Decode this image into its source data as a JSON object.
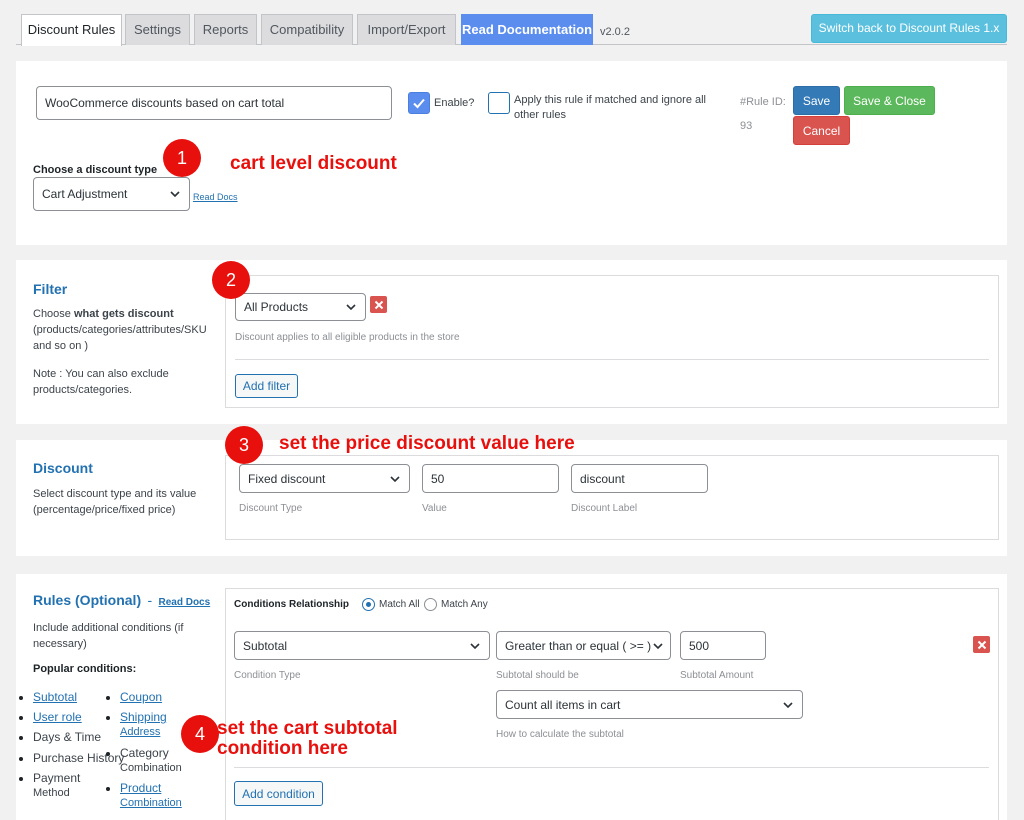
{
  "tabs": [
    {
      "label": "Discount Rules",
      "active": true
    },
    {
      "label": "Settings"
    },
    {
      "label": "Reports"
    },
    {
      "label": "Compatibility"
    },
    {
      "label": "Import/Export"
    },
    {
      "label": "Read Documentation"
    }
  ],
  "version": "v2.0.2",
  "switch_back_label": "Switch back to Discount Rules 1.x",
  "rule": {
    "title_value": "WooCommerce discounts based on cart total",
    "enable_label": "Enable?",
    "enable_checked": true,
    "apply_label_line1": "Apply this rule if matched and ignore all",
    "apply_label_line2": "other rules",
    "rule_id_label": "#Rule ID:",
    "rule_id_value": "93",
    "save_label": "Save",
    "save_close_label": "Save & Close",
    "cancel_label": "Cancel",
    "discount_type_label": "Choose a discount type",
    "discount_type_value": "Cart Adjustment",
    "read_docs_label": "Read Docs"
  },
  "filter": {
    "title": "Filter",
    "desc_prefix": "Choose ",
    "desc_bold": "what gets discount",
    "desc_line2": "(products/categories/attributes/SKU",
    "desc_line3": "and so on )",
    "note_line1": "Note : You can also exclude",
    "note_line2": "products/categories.",
    "select_value": "All Products",
    "hint": "Discount applies to all eligible products in the store",
    "add_filter_label": "Add filter"
  },
  "discount": {
    "title": "Discount",
    "desc_line1": "Select discount type and its value",
    "desc_line2": "(percentage/price/fixed price)",
    "type_value": "Fixed discount",
    "type_hint": "Discount Type",
    "value_value": "50",
    "value_hint": "Value",
    "label_value": "discount",
    "label_hint": "Discount Label"
  },
  "rules": {
    "title": "Rules (Optional)",
    "dash": "-",
    "read_docs_label": "Read Docs",
    "desc_line1": "Include additional conditions (if",
    "desc_line2": "necessary)",
    "popular_label": "Popular conditions:",
    "popular_left": [
      {
        "label": "Subtotal",
        "link": true
      },
      {
        "label": "User role",
        "link": true
      },
      {
        "label": "Days & Time",
        "link": false
      },
      {
        "label": "Purchase History",
        "link": false
      },
      {
        "label": "Payment",
        "link": false
      },
      {
        "label": "Method",
        "link": false
      }
    ],
    "popular_right": [
      {
        "label": "Coupon",
        "link": true
      },
      {
        "label": "Shipping",
        "link": true
      },
      {
        "label": "Address",
        "link": true
      },
      {
        "label": "Category",
        "link": false
      },
      {
        "label": "Combination",
        "link": false
      },
      {
        "label": "Product",
        "link": true
      },
      {
        "label": "Combination",
        "link": true
      }
    ],
    "relationship_label": "Conditions Relationship",
    "match_all_label": "Match All",
    "match_any_label": "Match Any",
    "condition_type_value": "Subtotal",
    "condition_type_hint": "Condition Type",
    "operator_value": "Greater than or equal ( >= )",
    "operator_hint": "Subtotal should be",
    "amount_value": "500",
    "amount_hint": "Subtotal Amount",
    "calc_value": "Count all items in cart",
    "calc_hint": "How to calculate the subtotal",
    "add_condition_label": "Add condition"
  },
  "annotations": [
    {
      "num": "1",
      "text": "cart level discount"
    },
    {
      "num": "2",
      "text": ""
    },
    {
      "num": "3",
      "text": "set the price discount value here"
    },
    {
      "num": "4",
      "text_line1": "set the cart subtotal",
      "text_line2": "condition here"
    }
  ],
  "colors": {
    "accent_blue": "#2271b1",
    "annotation_red": "#e8100d",
    "save_blue": "#337ab7",
    "save_green": "#5cb85c",
    "cancel_red": "#d9534f",
    "doc_tab": "#5b8def",
    "switch_btn": "#5bc0de"
  }
}
